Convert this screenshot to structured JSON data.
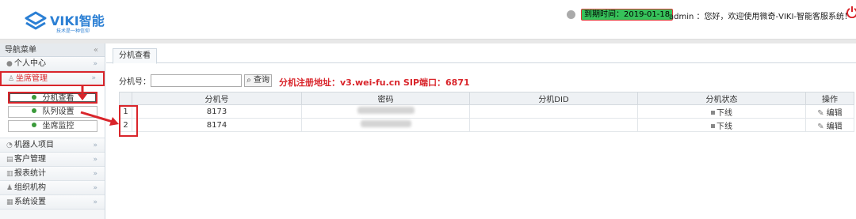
{
  "header": {
    "logo_name": "VIKI智能",
    "logo_slogan": "技术是一种信仰",
    "expire_text": "到期时间：2019-01-18",
    "welcome_text": "admin ：您好，欢迎使用微奇-VIKI-智能客服系统！",
    "colors": {
      "brand": "#2b7fd4",
      "accent": "#d9252b",
      "expire_bg": "#36c25a"
    }
  },
  "sidebar": {
    "title": "导航菜单",
    "collapse_glyph": "«",
    "items": [
      {
        "label": "个人中心",
        "icon": "user-circle-icon",
        "glyph": "●",
        "chev": "»"
      },
      {
        "label": "坐席管理",
        "icon": "user-icon",
        "glyph": "♙",
        "chev": "»"
      },
      {
        "label": "机器人项目",
        "icon": "robot-icon",
        "glyph": "◔",
        "chev": "»"
      },
      {
        "label": "客户管理",
        "icon": "table-icon",
        "glyph": "▤",
        "chev": "»"
      },
      {
        "label": "报表统计",
        "icon": "report-icon",
        "glyph": "▥",
        "chev": "»"
      },
      {
        "label": "组织机构",
        "icon": "org-icon",
        "glyph": "♟",
        "chev": "»"
      },
      {
        "label": "系统设置",
        "icon": "settings-icon",
        "glyph": "▦",
        "chev": "»"
      }
    ],
    "sub_items": [
      "分机查看",
      "队列设置",
      "坐席监控"
    ]
  },
  "main": {
    "tab_label": "分机查看",
    "search_label": "分机号：",
    "search_value": "",
    "query_label": "查询",
    "sip_info": "分机注册地址：v3.wei-fu.cn   SIP端口：6871",
    "columns": [
      "分机号",
      "密码",
      "分机DID",
      "分机状态",
      "操作"
    ],
    "rows": [
      {
        "index": "1",
        "ext": "8173",
        "status": "下线",
        "action": "编辑"
      },
      {
        "index": "2",
        "ext": "8174",
        "status": "下线",
        "action": "编辑"
      }
    ]
  }
}
